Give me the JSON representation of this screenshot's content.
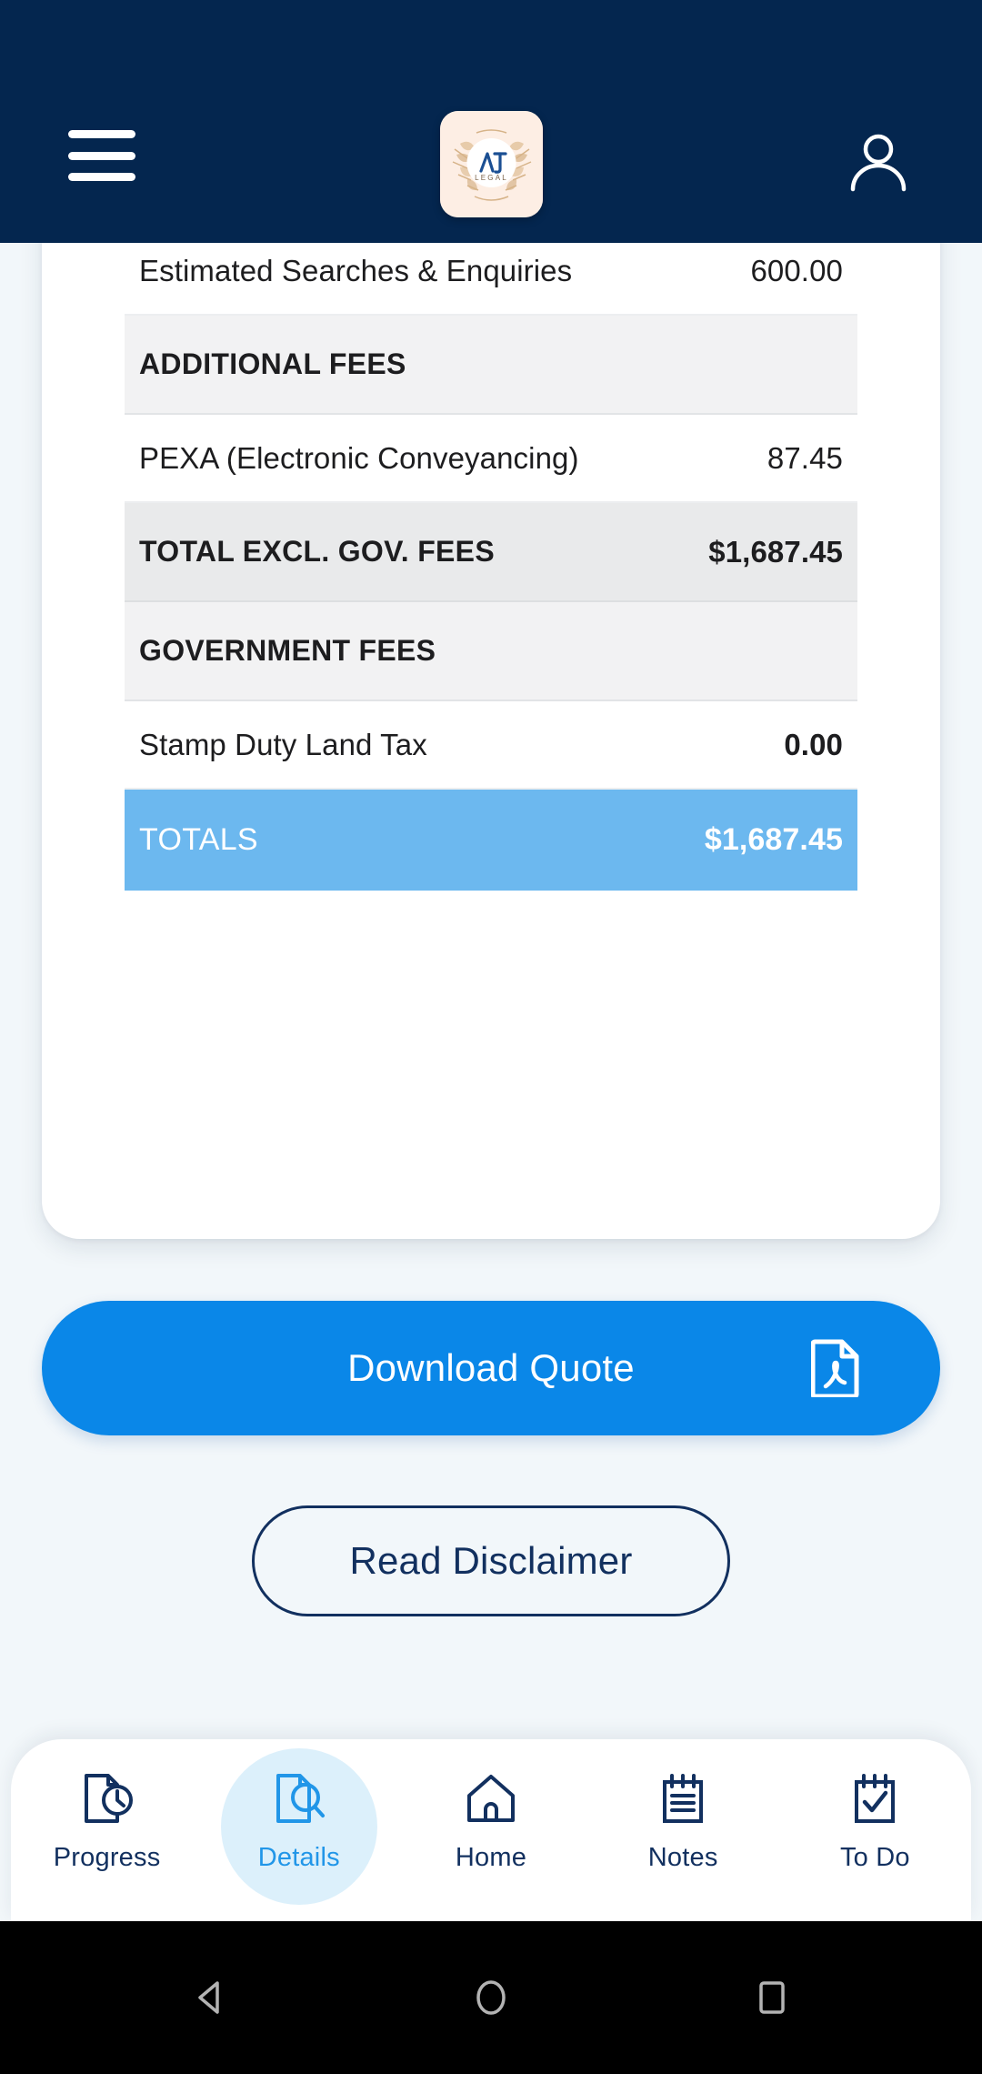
{
  "header": {
    "menu_icon": "hamburger-menu-icon",
    "logo_text": "AJT",
    "logo_subtext": "LEGAL",
    "profile_icon": "user-account-icon"
  },
  "quote": {
    "rows": [
      {
        "label": "Estimated Searches & Enquiries",
        "value": "600.00",
        "type": "item",
        "bold_value": false
      },
      {
        "label": "ADDITIONAL FEES",
        "value": "",
        "type": "section",
        "bold_value": false
      },
      {
        "label": "PEXA (Electronic Conveyancing)",
        "value": "87.45",
        "type": "item",
        "bold_value": false
      },
      {
        "label": "TOTAL EXCL. GOV. FEES",
        "value": "$1,687.45",
        "type": "subtotal",
        "bold_value": true
      },
      {
        "label": "GOVERNMENT FEES",
        "value": "",
        "type": "section",
        "bold_value": false
      },
      {
        "label": "Stamp Duty Land Tax",
        "value": "0.00",
        "type": "item",
        "bold_value": true
      },
      {
        "label": "TOTALS",
        "value": "$1,687.45",
        "type": "totals",
        "bold_value": true
      }
    ]
  },
  "actions": {
    "download_label": "Download Quote",
    "download_icon": "pdf-file-icon",
    "disclaimer_label": "Read Disclaimer"
  },
  "tabbar": {
    "items": [
      {
        "label": "Progress",
        "icon": "document-clock-icon",
        "active": false
      },
      {
        "label": "Details",
        "icon": "document-search-icon",
        "active": true
      },
      {
        "label": "Home",
        "icon": "house-icon",
        "active": false
      },
      {
        "label": "Notes",
        "icon": "notepad-lines-icon",
        "active": false
      },
      {
        "label": "To Do",
        "icon": "notepad-check-icon",
        "active": false
      }
    ]
  },
  "android_nav": {
    "back": "back-triangle-icon",
    "home": "home-circle-icon",
    "recents": "recents-square-icon"
  },
  "colors": {
    "header_navy": "#04264f",
    "page_background": "#f2f7fa",
    "totals_blue": "#6cb8ef",
    "primary_blue": "#0a87e8",
    "active_tab_blue": "#2196e8",
    "tab_navy": "#12305f",
    "section_gray": "#f2f2f3",
    "subtotal_gray": "#e9eaeb"
  }
}
